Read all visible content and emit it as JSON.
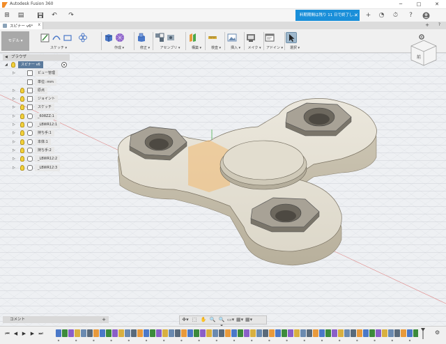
{
  "window": {
    "title": "Autodesk Fusion 360",
    "minimize": "─",
    "maximize": "□",
    "close": "✕"
  },
  "quick_access": {
    "grid_icon": "⊞",
    "file_icon": "▤",
    "save_icon": "💾",
    "undo_icon": "↶",
    "redo_icon": "↷",
    "trial_text": "料期期間は残り 11 日で終了し...",
    "trial_close": "✕",
    "right_icons": [
      "+",
      "◔",
      "⏱",
      "?",
      "●"
    ]
  },
  "document_tab": {
    "name": "スピナー v6*",
    "close": "x",
    "new_tab": "+",
    "help": "?"
  },
  "ribbon": {
    "workspace": "モデル ▾",
    "groups": [
      {
        "label": "スケッチ ▾",
        "key": "sketch"
      },
      {
        "label": "作成 ▾",
        "key": "create"
      },
      {
        "label": "修正 ▾",
        "key": "modify"
      },
      {
        "label": "アセンブリ ▾",
        "key": "assemble"
      },
      {
        "label": "構築 ▾",
        "key": "construct"
      },
      {
        "label": "検査 ▾",
        "key": "inspect"
      },
      {
        "label": "挿入 ▾",
        "key": "insert"
      },
      {
        "label": "メイク ▾",
        "key": "make"
      },
      {
        "label": "アドイン ▾",
        "key": "addins"
      },
      {
        "label": "選択 ▾",
        "key": "select"
      }
    ],
    "colors": {
      "sketch": "#3c8a3c",
      "create_blue": "#4a78c8",
      "create_purple": "#8a5fc8",
      "modify": "#4a78c8",
      "assemble": "#5a6a7a",
      "construct_orange": "#e89a3c",
      "construct_green": "#4aa84a",
      "inspect": "#d8b040",
      "insert": "#6a8ab0",
      "make": "#555555",
      "addins": "#777777",
      "select": "#4a78c8"
    }
  },
  "browser": {
    "title": "ブラウザ",
    "root": "スピナー v6",
    "items": [
      {
        "label": "ビュー管理",
        "icon": "folder-icon",
        "bulb": false,
        "expand": true
      },
      {
        "label": "単位: mm",
        "icon": "document-icon",
        "bulb": false,
        "expand": false
      },
      {
        "label": "原点",
        "icon": "folder-icon",
        "bulb": true,
        "expand": true
      },
      {
        "label": "ジョイント",
        "icon": "folder-icon",
        "bulb": true,
        "expand": true
      },
      {
        "label": "スケッチ",
        "icon": "folder-icon",
        "bulb": true,
        "expand": true
      },
      {
        "label": "_608ZZ:1",
        "icon": "body-icon",
        "bulb": true,
        "expand": true
      },
      {
        "label": "_LBWR12:1",
        "icon": "body-icon",
        "bulb": true,
        "expand": true
      },
      {
        "label": "持ち手:1",
        "icon": "body-icon",
        "bulb": true,
        "expand": true
      },
      {
        "label": "本体:1",
        "icon": "body-icon",
        "bulb": true,
        "expand": true
      },
      {
        "label": "持ち手:2",
        "icon": "body-icon",
        "bulb": true,
        "expand": true
      },
      {
        "label": "_LBWR12:2",
        "icon": "body-icon",
        "bulb": true,
        "expand": true
      },
      {
        "label": "_LBWR12:3",
        "icon": "body-icon",
        "bulb": true,
        "expand": true
      }
    ]
  },
  "comment": {
    "label": "コメント",
    "add": "+"
  },
  "nav_toolbar": {
    "icons": [
      "✥▾",
      "⬚",
      "✋",
      "🔍",
      "🔍▾",
      "▭▾",
      "▦▾",
      "▦▾"
    ]
  },
  "timeline": {
    "controls": [
      "⏮",
      "◀",
      "▶",
      "▶",
      "⏭"
    ],
    "feature_count": 62,
    "gear": "⚙"
  },
  "navcube": {
    "label": "前"
  }
}
